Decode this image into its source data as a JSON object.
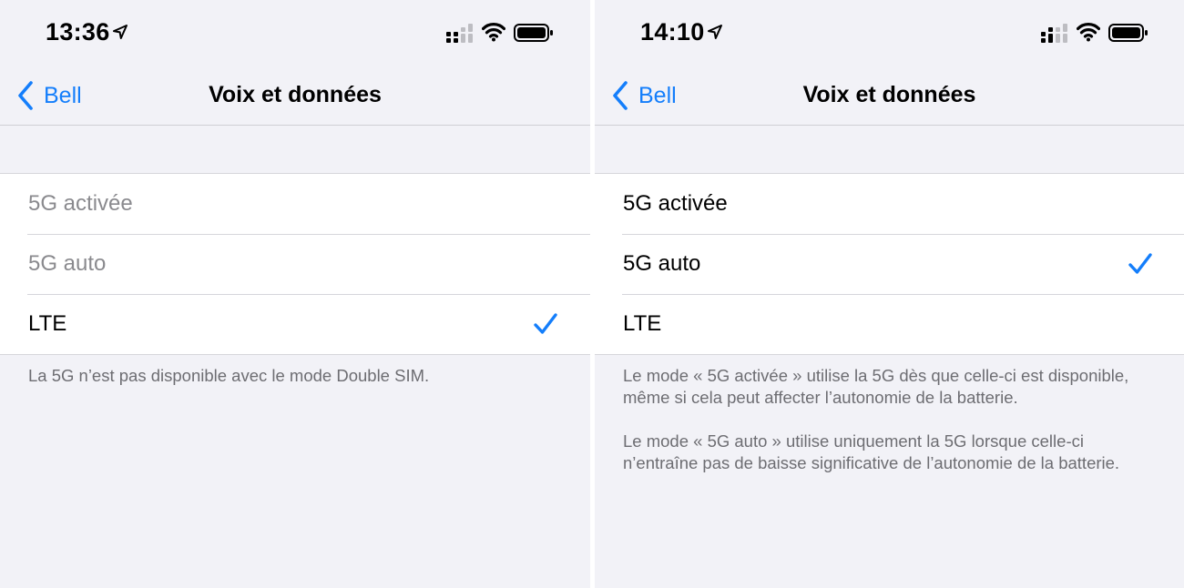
{
  "screens": [
    {
      "status_bar": {
        "time": "13:36"
      },
      "nav": {
        "back_label": "Bell",
        "title": "Voix et données"
      },
      "options": [
        {
          "label": "5G activée",
          "enabled": false,
          "selected": false
        },
        {
          "label": "5G auto",
          "enabled": false,
          "selected": false
        },
        {
          "label": "LTE",
          "enabled": true,
          "selected": true
        }
      ],
      "footer": [
        "La 5G n’est pas disponible avec le mode Double SIM."
      ]
    },
    {
      "status_bar": {
        "time": "14:10"
      },
      "nav": {
        "back_label": "Bell",
        "title": "Voix et données"
      },
      "options": [
        {
          "label": "5G activée",
          "enabled": true,
          "selected": false
        },
        {
          "label": "5G auto",
          "enabled": true,
          "selected": true
        },
        {
          "label": "LTE",
          "enabled": true,
          "selected": false
        }
      ],
      "footer": [
        "Le mode « 5G activée » utilise la 5G dès que celle-ci est disponible, même si cela peut affecter l’autonomie de la batterie.",
        "Le mode « 5G auto » utilise uniquement la 5G lorsque celle-ci n’entraîne pas de baisse significative de l’autonomie de la batterie."
      ]
    }
  ],
  "colors": {
    "accent": "#147efb",
    "background": "#f2f2f7",
    "disabled_text": "#8a8a8e",
    "footer_text": "#6d6d72"
  },
  "icons": [
    "location-arrow-icon",
    "cellular-signal-icon",
    "wifi-icon",
    "battery-icon",
    "chevron-left-icon",
    "checkmark-icon"
  ]
}
